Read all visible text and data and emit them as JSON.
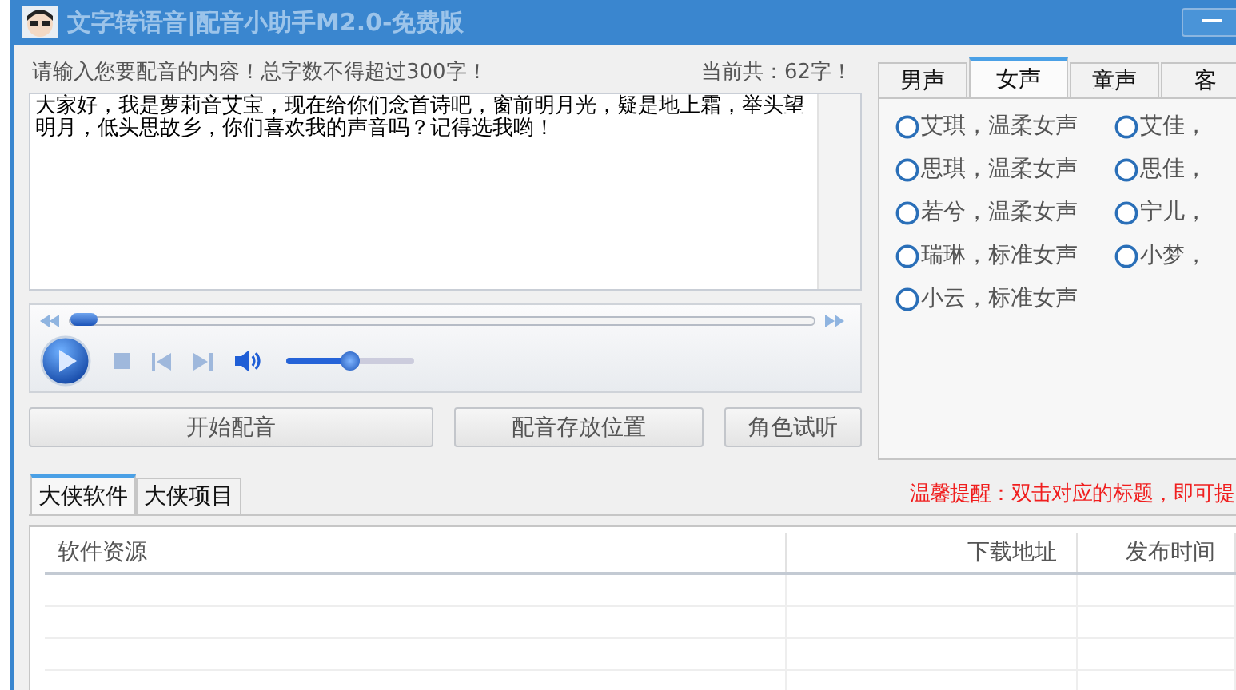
{
  "window": {
    "title": "文字转语音|配音小助手M2.0-免费版"
  },
  "input": {
    "prompt": "请输入您要配音的内容！总字数不得超过300字！",
    "count": "当前共：62字！",
    "value": "大家好，我是萝莉音艾宝，现在给你们念首诗吧，窗前明月光，疑是地上霜，举头望明月，低头思故乡，你们喜欢我的声音吗？记得选我哟！"
  },
  "player": {
    "seek": {
      "level": 0
    },
    "volume": {
      "level": 0.5
    }
  },
  "buttons": [
    "开始配音",
    "配音存放位置",
    "角色试听"
  ],
  "voice_tabs": [
    {
      "label": "男声",
      "selected": false
    },
    {
      "label": "女声",
      "selected": true
    },
    {
      "label": "童声",
      "selected": false
    },
    {
      "label": "客",
      "selected": false
    }
  ],
  "voices": [
    {
      "label": "艾琪，温柔女声",
      "selected": false
    },
    {
      "label": "艾佳，",
      "selected": false
    },
    {
      "label": "思琪，温柔女声",
      "selected": false
    },
    {
      "label": "思佳，",
      "selected": false
    },
    {
      "label": "若兮，温柔女声",
      "selected": false
    },
    {
      "label": "宁儿，",
      "selected": false
    },
    {
      "label": "瑞琳，标准女声",
      "selected": false
    },
    {
      "label": "小梦，",
      "selected": false
    },
    {
      "label": "小云，标准女声",
      "selected": false
    }
  ],
  "bottom_tabs": [
    {
      "label": "大侠软件",
      "selected": true
    },
    {
      "label": "大侠项目",
      "selected": false
    }
  ],
  "hint": "温馨提醒：双击对应的标题，即可提",
  "table": {
    "columns": [
      "软件资源",
      "下载地址",
      "发布时间"
    ]
  }
}
